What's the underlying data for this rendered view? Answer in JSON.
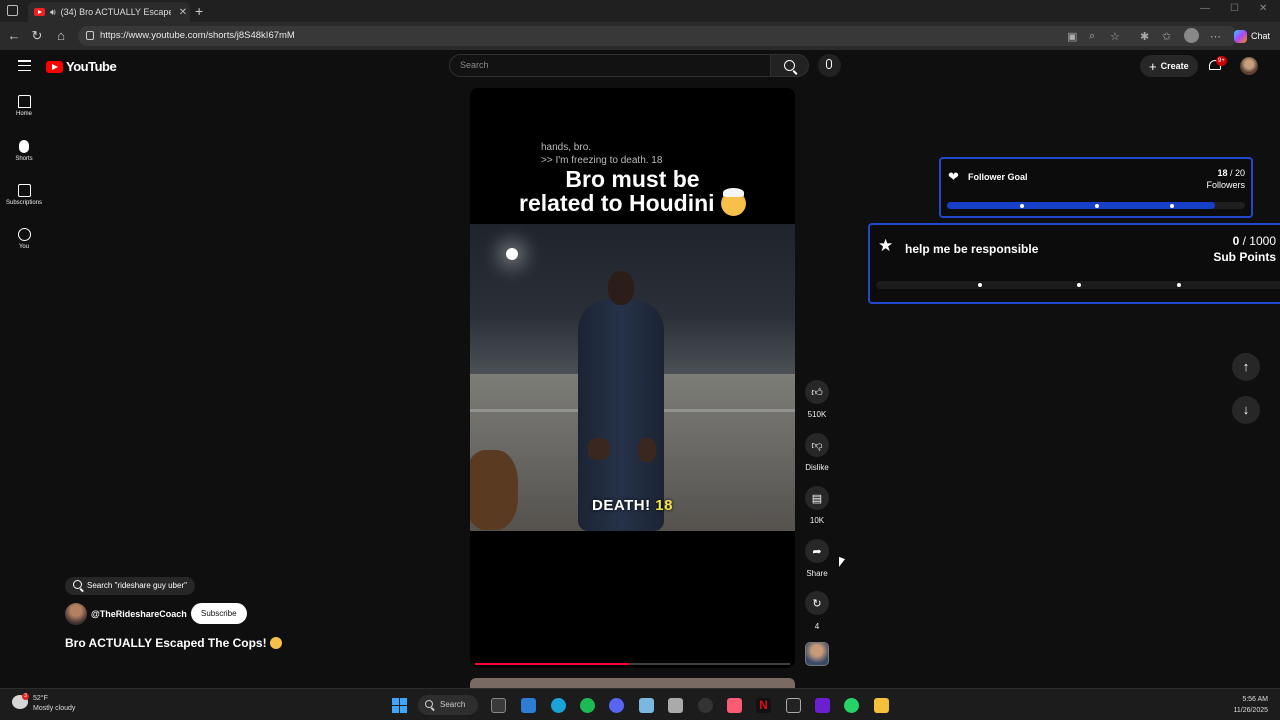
{
  "browser": {
    "tab_title": "(34) Bro ACTUALLY Escaped",
    "url": "https://www.youtube.com/shorts/j8S48kI67mM",
    "chat_label": "Chat"
  },
  "header": {
    "logo": "YouTube",
    "search_placeholder": "Search",
    "create_label": "Create",
    "notification_count": "9+"
  },
  "sidebar": {
    "items": [
      {
        "label": "Home",
        "icon": "home-icon"
      },
      {
        "label": "Shorts",
        "icon": "shorts-icon"
      },
      {
        "label": "Subscriptions",
        "icon": "subscriptions-icon"
      },
      {
        "label": "You",
        "icon": "you-icon"
      }
    ]
  },
  "video": {
    "caption_small": [
      "hands, bro.",
      ">> I'm freezing to death. 18"
    ],
    "headline": [
      "Bro must be",
      "related to Houdini"
    ],
    "subtitle_word": "DEATH!",
    "subtitle_num": "18",
    "progress_fraction": 0.49
  },
  "actions": {
    "likes": "510K",
    "dislike_label": "Dislike",
    "comments": "10K",
    "share_label": "Share",
    "remix_count": "4"
  },
  "meta": {
    "search_chip": "Search \"rideshare guy uber\"",
    "channel_handle": "@TheRideshareCoach",
    "subscribe_label": "Subscribe",
    "title": "Bro ACTUALLY Escaped The Cops!"
  },
  "overlays": {
    "follower_goal": {
      "label": "Follower Goal",
      "current": "18",
      "target": "/ 20",
      "unit": "Followers",
      "progress_fraction": 0.9
    },
    "sub_goal": {
      "label": "help me be responsible",
      "current": "0",
      "target": "/ 1000",
      "unit": "Sub Points",
      "progress_fraction": 0.0
    }
  },
  "taskbar": {
    "temperature": "52°F",
    "weather": "Mostly cloudy",
    "weather_badge": "3",
    "search_label": "Search",
    "time": "5:56 AM",
    "date": "11/26/2025"
  }
}
